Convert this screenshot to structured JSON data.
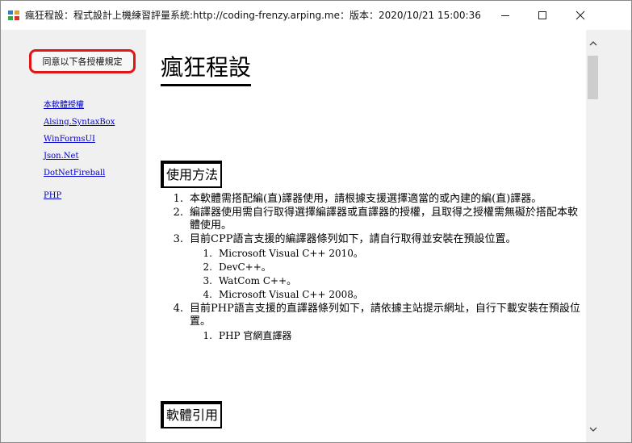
{
  "window": {
    "title": "瘋狂程設：程式設計上機練習評量系統:http://coding-frenzy.arping.me：版本：2020/10/21 15:00:36",
    "icon": "app-icon",
    "controls": {
      "minimize": "minimize-icon",
      "maximize": "maximize-icon",
      "close": "close-icon"
    }
  },
  "sidebar": {
    "agree_button": "同意以下各授權規定",
    "links": [
      "本軟體授權",
      "Alsing.SyntaxBox",
      "WinFormsUI",
      "Json.Net",
      "DotNetFireball",
      "PHP"
    ]
  },
  "content": {
    "title": "瘋狂程設",
    "usage_heading": "使用方法",
    "usage_items": [
      {
        "num": "1.",
        "text": "本軟體需搭配編(直)譯器使用，請根據支援選擇適當的或內建的編(直)譯器。",
        "sub": []
      },
      {
        "num": "2.",
        "text": "編譯器使用需自行取得選擇編譯器或直譯器的授權，且取得之授權需無礙於搭配本軟體使用。",
        "sub": []
      },
      {
        "num": "3.",
        "text": "目前CPP語言支援的編譯器條列如下，請自行取得並安裝在預設位置。",
        "sub": [
          {
            "num": "1.",
            "text": "Microsoft Visual C++ 2010。"
          },
          {
            "num": "2.",
            "text": "DevC++。"
          },
          {
            "num": "3.",
            "text": "WatCom C++。"
          },
          {
            "num": "4.",
            "text": "Microsoft Visual C++ 2008。"
          }
        ]
      },
      {
        "num": "4.",
        "text": "目前PHP語言支援的直譯器條列如下，請依據主站提示網址，自行下載安裝在預設位置。",
        "sub": [
          {
            "num": "1.",
            "text": "PHP 官網直譯器"
          }
        ]
      }
    ],
    "cite_heading": "軟體引用"
  },
  "colors": {
    "agree_border": "#e01515",
    "link": "#0000cc",
    "window_bg": "#f0f0f0"
  }
}
